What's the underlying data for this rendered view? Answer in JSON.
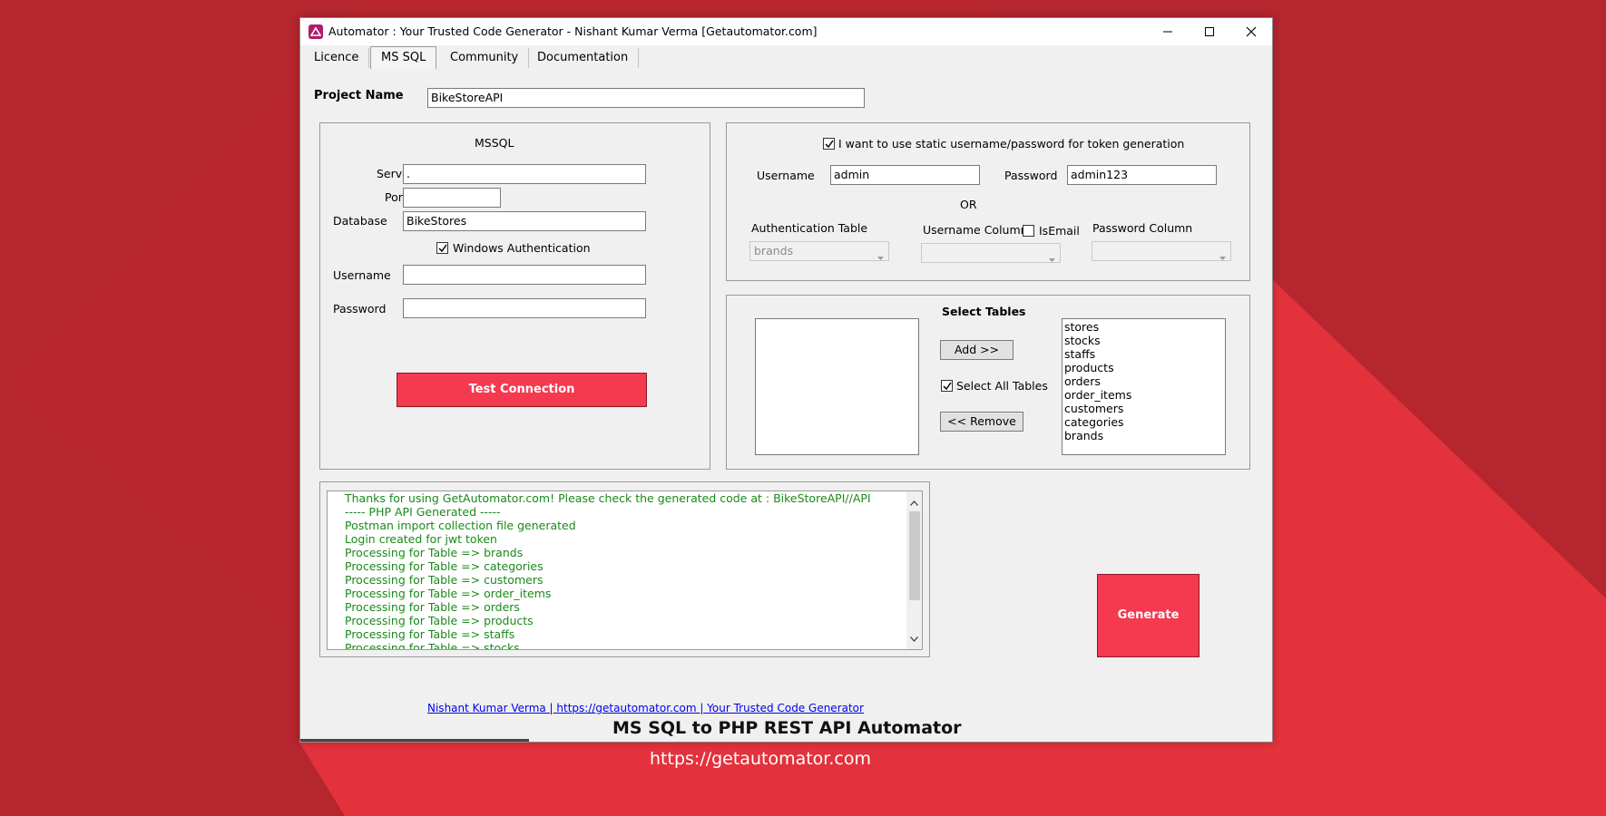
{
  "window": {
    "title": "Automator : Your Trusted Code Generator - Nishant Kumar Verma [Getautomator.com]"
  },
  "tabs": [
    {
      "label": "Licence"
    },
    {
      "label": "MS SQL",
      "active": true
    },
    {
      "label": "Community"
    },
    {
      "label": "Documentation"
    }
  ],
  "project": {
    "label": "Project Name",
    "value": "BikeStoreAPI"
  },
  "mssql": {
    "title": "MSSQL",
    "server_label": "Server",
    "server_value": ".",
    "port_label": "Port",
    "port_value": "",
    "database_label": "Database",
    "database_value": "BikeStores",
    "windows_auth_label": "Windows Authentication",
    "windows_auth_checked": true,
    "username_label": "Username",
    "username_value": "",
    "password_label": "Password",
    "password_value": "",
    "test_button": "Test Connection"
  },
  "token": {
    "static_label": "I want to use static username/password for token generation",
    "static_checked": true,
    "username_label": "Username",
    "username_value": "admin",
    "password_label": "Password",
    "password_value": "admin123",
    "or_label": "OR",
    "auth_table_label": "Authentication Table",
    "auth_table_value": "brands",
    "username_column_label": "Username Column",
    "username_column_value": "",
    "isemail_label": "IsEmail",
    "isemail_checked": false,
    "password_column_label": "Password Column",
    "password_column_value": ""
  },
  "tables": {
    "title": "Select Tables",
    "available": [],
    "add_button": "Add >>",
    "select_all_label": "Select All Tables",
    "select_all_checked": true,
    "remove_button": "<< Remove",
    "selected": [
      "stores",
      "stocks",
      "staffs",
      "products",
      "orders",
      "order_items",
      "customers",
      "categories",
      "brands"
    ]
  },
  "log": {
    "lines": [
      "Thanks for using GetAutomator.com! Please check the generated code at : BikeStoreAPI//API",
      "----- PHP API Generated -----",
      "Postman import collection file generated",
      "Login created for jwt token",
      "Processing for Table => brands",
      "Processing for Table => categories",
      "Processing for Table => customers",
      "Processing for Table => order_items",
      "Processing for Table => orders",
      "Processing for Table => products",
      "Processing for Table => staffs",
      "Processing for Table => stocks"
    ]
  },
  "generate_button": "Generate",
  "footer": {
    "link": "Nishant Kumar Verma | https://getautomator.com | Your Trusted Code Generator"
  },
  "caption": {
    "title": "MS SQL to PHP REST API Automator",
    "url": "https://getautomator.com"
  },
  "colors": {
    "background_dark": "#b5262f",
    "background_light": "#e3323b",
    "accent_button": "#f5394f",
    "log_text": "#1a8a1a",
    "link": "#0000ee"
  }
}
